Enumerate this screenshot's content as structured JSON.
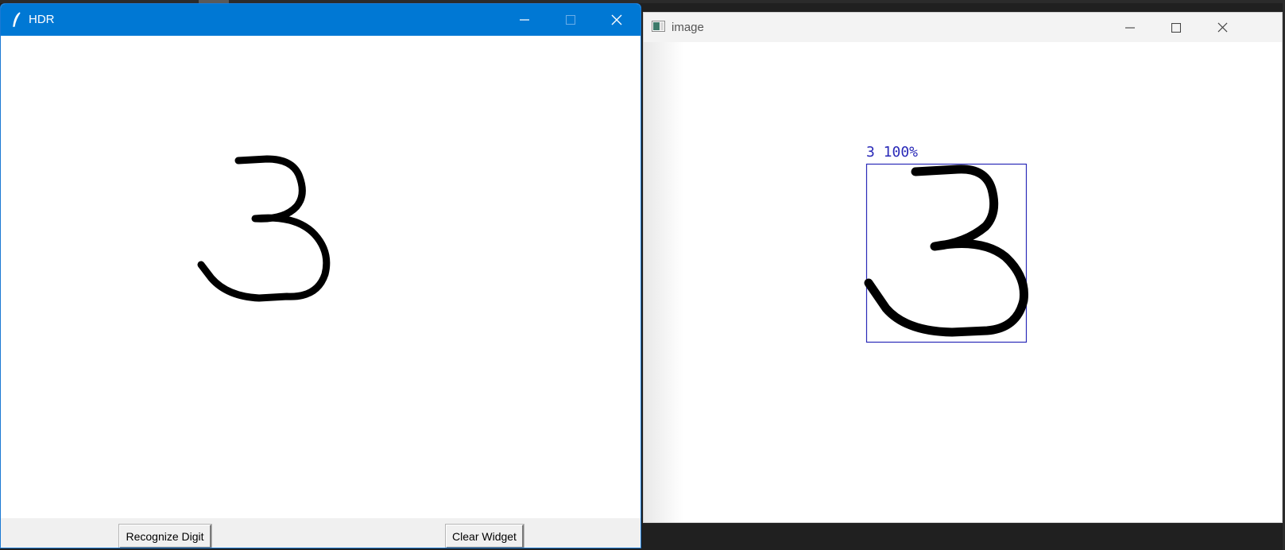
{
  "hdr_window": {
    "title": "HDR",
    "icons": {
      "app": "feather-icon",
      "minimize": "minimize-icon",
      "maximize": "maximize-icon",
      "close": "close-icon"
    },
    "buttons": {
      "recognize": "Recognize Digit",
      "clear": "Clear Widget"
    },
    "title_bar_color": "#0078d4"
  },
  "image_window": {
    "title": "image",
    "icons": {
      "app": "image-window-icon",
      "minimize": "minimize-icon",
      "maximize": "maximize-icon",
      "close": "close-icon"
    },
    "prediction": {
      "digit": "3",
      "confidence": "100%",
      "label": "3 100%"
    },
    "box_color": "#2a2ab8"
  }
}
